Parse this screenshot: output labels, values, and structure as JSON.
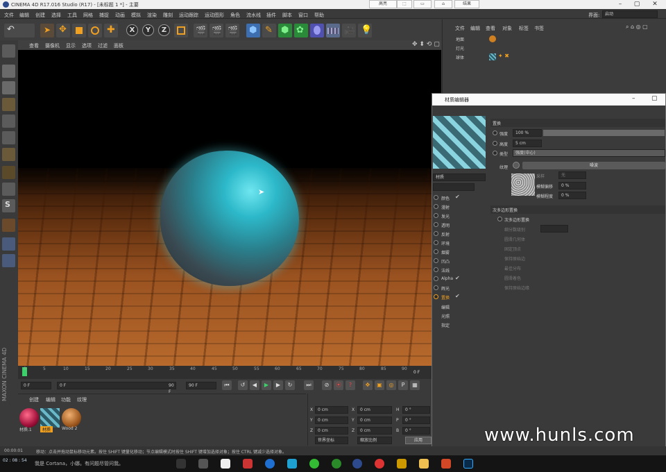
{
  "window": {
    "title": "CINEMA 4D R17.016 Studio (R17) - [未标题 1 *] - 主要",
    "buttons": [
      "高亮",
      "结果"
    ]
  },
  "menubar": {
    "items": [
      "文件",
      "编辑",
      "创建",
      "选择",
      "工具",
      "网格",
      "捕捉",
      "动画",
      "模拟",
      "渲染",
      "雕刻",
      "运动跟踪",
      "运动图形",
      "角色",
      "流水线",
      "插件",
      "脚本",
      "窗口",
      "帮助"
    ],
    "layout_label": "界面:",
    "layout_value": "启动"
  },
  "viewport": {
    "menu": [
      "查看",
      "摄像机",
      "显示",
      "选项",
      "过滤",
      "面板"
    ]
  },
  "timeline": {
    "ticks": [
      "0",
      "5",
      "10",
      "15",
      "20",
      "25",
      "30",
      "35",
      "40",
      "45",
      "50",
      "55",
      "60",
      "65",
      "70",
      "75",
      "80",
      "85",
      "90"
    ],
    "end_marker": "0 F"
  },
  "transport": {
    "current": "0 F",
    "start": "0 F",
    "end": "90 F",
    "end2": "90 F"
  },
  "material_manager": {
    "menu": [
      "创建",
      "编辑",
      "功能",
      "纹理"
    ],
    "materials": [
      {
        "name": "材质.1"
      },
      {
        "name": "材质"
      },
      {
        "name": "Wood 2"
      }
    ],
    "brand": "MAXON CINEMA 4D"
  },
  "coordinates": {
    "rows": [
      {
        "a": "X",
        "av": "0 cm",
        "b": "X",
        "bv": "0 cm",
        "c": "H",
        "cv": "0 °"
      },
      {
        "a": "Y",
        "av": "0 cm",
        "b": "Y",
        "bv": "0 cm",
        "c": "P",
        "cv": "0 °"
      },
      {
        "a": "Z",
        "av": "0 cm",
        "b": "Z",
        "bv": "0 cm",
        "c": "B",
        "cv": "0 °"
      }
    ],
    "mode1": "世界坐标",
    "mode2": "缩放比例",
    "apply": "应用"
  },
  "object_manager": {
    "menu": [
      "文件",
      "编辑",
      "查看",
      "对象",
      "标签",
      "书签"
    ],
    "objects": [
      "地面",
      "灯光",
      "球体"
    ]
  },
  "material_editor": {
    "title": "材质编辑器",
    "material_name": "材质",
    "channels": [
      {
        "name": "颜色",
        "on": true
      },
      {
        "name": "漫射",
        "on": false
      },
      {
        "name": "发光",
        "on": false
      },
      {
        "name": "透明",
        "on": false
      },
      {
        "name": "反射",
        "on": false
      },
      {
        "name": "环境",
        "on": false
      },
      {
        "name": "烟雾",
        "on": false
      },
      {
        "name": "凹凸",
        "on": false
      },
      {
        "name": "法线",
        "on": false
      },
      {
        "name": "Alpha",
        "on": true
      },
      {
        "name": "辉光",
        "on": false
      },
      {
        "name": "置换",
        "on": true
      }
    ],
    "extras": [
      "编辑",
      "光照",
      "指定"
    ],
    "section": "置换",
    "params": [
      {
        "label": "强度",
        "value": "100 %"
      },
      {
        "label": "高度",
        "value": "5 cm"
      },
      {
        "label": "类型",
        "value": "强度(中心)"
      }
    ],
    "texture_label": "纹理",
    "texture_name": "噪波",
    "sampling_label": "采样",
    "sampling_value": "无",
    "blur_offset_label": "模糊偏移",
    "blur_offset_value": "0 %",
    "blur_scale_label": "模糊程度",
    "blur_scale_value": "0 %",
    "subpoly_section": "次多边形置换",
    "subpoly_items": [
      "次多边形置换",
      "细分数级别",
      "圆滑几何体",
      "固定顶点",
      "保持原始边",
      "最佳分布",
      "圆滑着色",
      "保持原始边缘"
    ]
  },
  "status_bar": {
    "time": "00:00:01",
    "text": "移动：点击并拖动鼠标移动元素。按住 SHIFT 键量化移动；节点编辑模式时按住 SHIFT 键增加选择对象；按住 CTRL 键减少选择对象。"
  },
  "taskbar": {
    "clock": "02 : 08 : 54",
    "search": "我是 Cortana，小娜。有问题尽管问我。"
  },
  "watermark": "www.hunls.com",
  "colors": {
    "accent_orange": "#f0a020",
    "selection_blue": "#2f6fbf"
  }
}
